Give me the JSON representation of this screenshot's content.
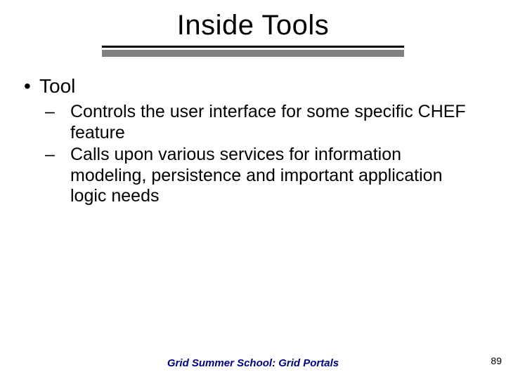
{
  "title": "Inside Tools",
  "bullets": {
    "b1": "Tool",
    "sub1": "Controls the user interface for some specific CHEF feature",
    "sub2": "Calls upon various services for information modeling, persistence and important application logic needs"
  },
  "footer": "Grid Summer School: Grid Portals",
  "page": "89"
}
